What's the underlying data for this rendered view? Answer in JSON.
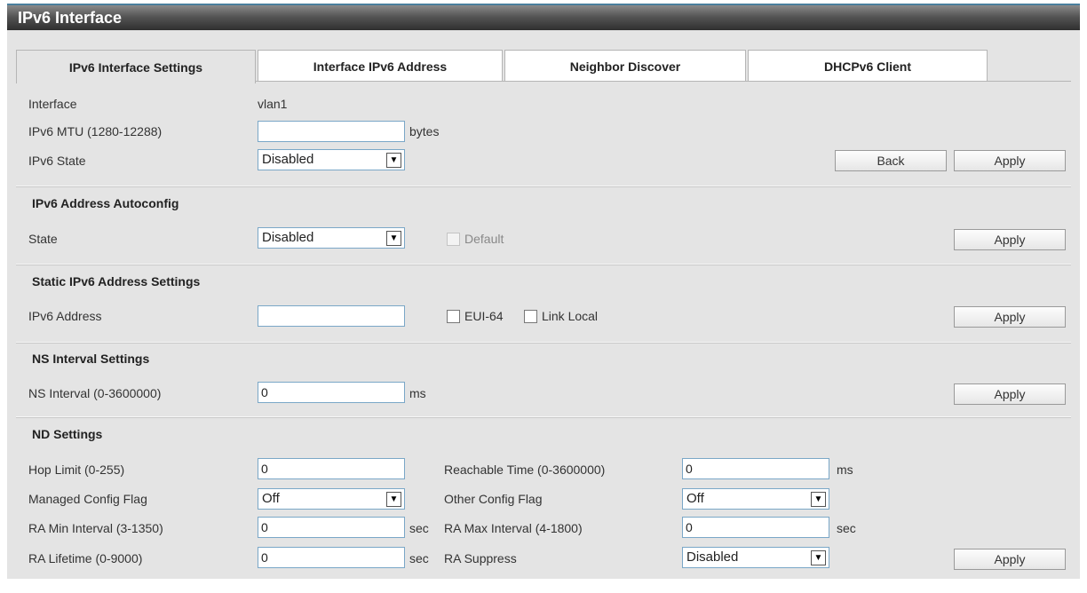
{
  "window": {
    "title": "IPv6 Interface"
  },
  "tabs": [
    {
      "label": "IPv6 Interface Settings",
      "active": true
    },
    {
      "label": "Interface IPv6 Address",
      "active": false
    },
    {
      "label": "Neighbor Discover",
      "active": false
    },
    {
      "label": "DHCPv6 Client",
      "active": false
    }
  ],
  "interface_settings": {
    "interface_label": "Interface",
    "interface_value": "vlan1",
    "mtu_label": "IPv6 MTU (1280-12288)",
    "mtu_value": "",
    "mtu_unit": "bytes",
    "state_label": "IPv6 State",
    "state_value": "Disabled",
    "back_label": "Back",
    "apply_label": "Apply"
  },
  "autoconfig": {
    "title": "IPv6 Address Autoconfig",
    "state_label": "State",
    "state_value": "Disabled",
    "default_label": "Default",
    "apply_label": "Apply"
  },
  "static_address": {
    "title": "Static IPv6 Address Settings",
    "address_label": "IPv6 Address",
    "address_value": "",
    "eui64_label": "EUI-64",
    "link_local_label": "Link Local",
    "apply_label": "Apply"
  },
  "ns_interval": {
    "title": "NS Interval Settings",
    "interval_label": "NS Interval (0-3600000)",
    "interval_value": "0",
    "interval_unit": "ms",
    "apply_label": "Apply"
  },
  "nd_settings": {
    "title": "ND Settings",
    "hop_limit_label": "Hop Limit (0-255)",
    "hop_limit_value": "0",
    "reachable_label": "Reachable Time (0-3600000)",
    "reachable_value": "0",
    "reachable_unit": "ms",
    "managed_label": "Managed Config Flag",
    "managed_value": "Off",
    "other_label": "Other Config Flag",
    "other_value": "Off",
    "ra_min_label": "RA Min Interval (3-1350)",
    "ra_min_value": "0",
    "ra_min_unit": "sec",
    "ra_max_label": "RA Max Interval (4-1800)",
    "ra_max_value": "0",
    "ra_max_unit": "sec",
    "ra_lifetime_label": "RA Lifetime (0-9000)",
    "ra_lifetime_value": "0",
    "ra_lifetime_unit": "sec",
    "ra_suppress_label": "RA Suppress",
    "ra_suppress_value": "Disabled",
    "apply_label": "Apply"
  },
  "icons": {
    "dropdown": "chevron-down-icon"
  },
  "colors": {
    "title_bar": "#3a3a3a",
    "panel": "#e4e4e4",
    "input_border": "#7aa7c7"
  }
}
